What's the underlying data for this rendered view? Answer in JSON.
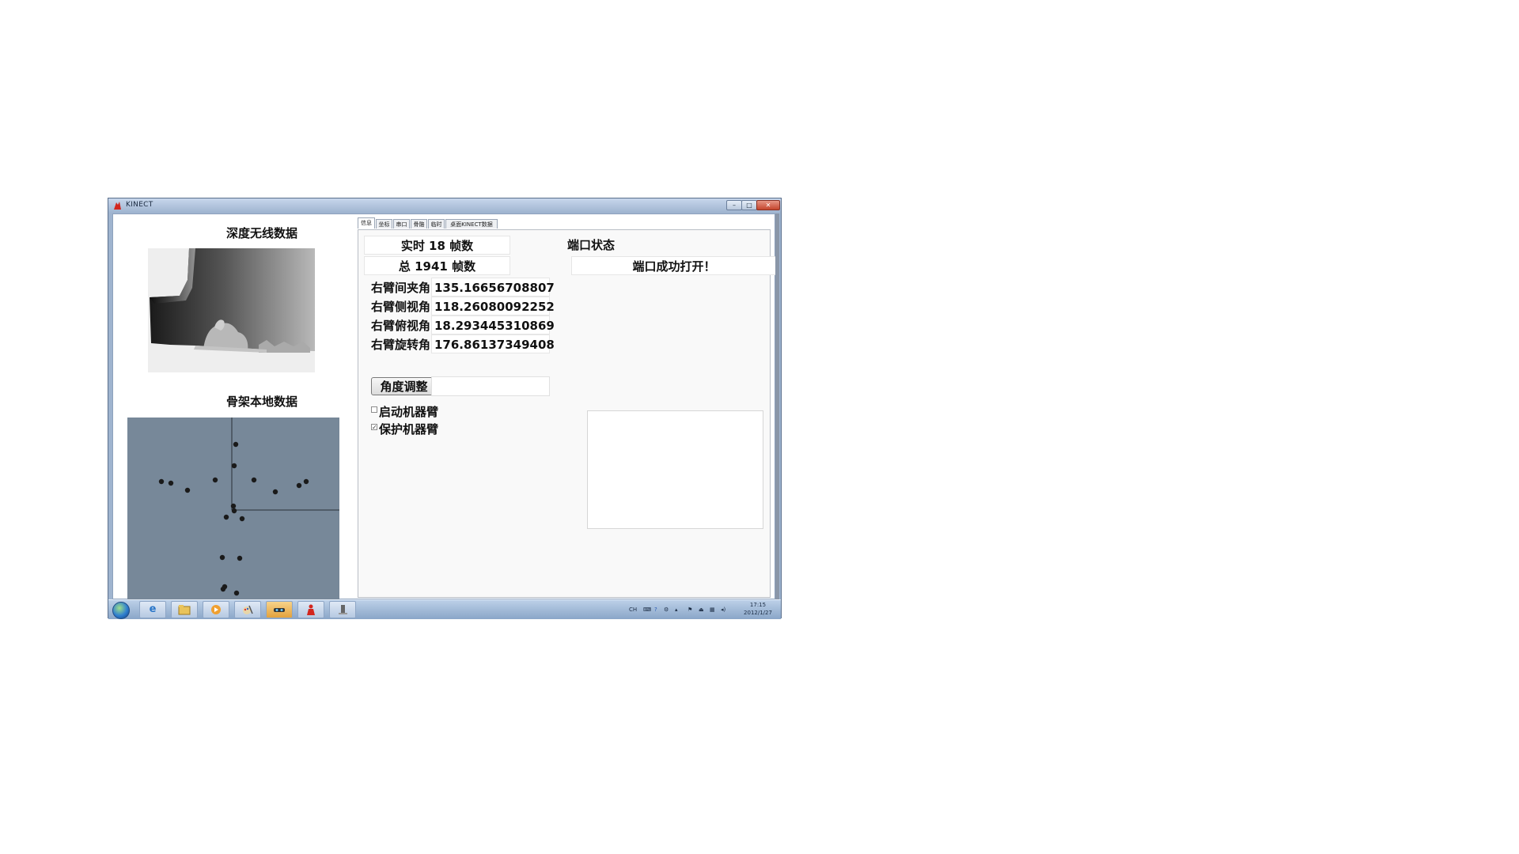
{
  "window": {
    "title": "KINECT",
    "min_glyph": "–",
    "max_glyph": "□",
    "close_glyph": "✕"
  },
  "left_panel": {
    "depth_title": "深度无线数据",
    "skeleton_title": "骨架本地数据"
  },
  "tabs": [
    {
      "label": "信息",
      "active": true
    },
    {
      "label": "坐标",
      "active": false
    },
    {
      "label": "串口",
      "active": false
    },
    {
      "label": "骨骼",
      "active": false
    },
    {
      "label": "临时",
      "active": false
    },
    {
      "label": "桌面KINECT数据",
      "active": false
    }
  ],
  "info": {
    "fps_text": "实时 18 帧数",
    "total_text": "总 1941 帧数",
    "port_title": "端口状态",
    "port_status": "端口成功打开！",
    "rows": [
      {
        "label": "右臂间夹角",
        "value": "135.16656708807"
      },
      {
        "label": "右臂侧视角",
        "value": "118.26080092252"
      },
      {
        "label": "右臂俯视角",
        "value": "18.293445310869"
      },
      {
        "label": "右臂旋转角",
        "value": "176.86137349408"
      }
    ],
    "adjust_button": "角度调整",
    "adjust_value": "",
    "checkboxes": [
      {
        "label": "启动机器臂",
        "checked": false
      },
      {
        "label": "保护机器臂",
        "checked": true
      }
    ],
    "check_glyph": "✓"
  },
  "taskbar": {
    "icons": [
      "windows-start-icon",
      "internet-explorer-icon",
      "folder-icon",
      "media-player-icon",
      "paint-icon",
      "kinect-app-icon",
      "kinect-red-icon",
      "device-icon"
    ],
    "tray_lang": "CH",
    "clock_time": "17:15",
    "clock_date": "2012/1/27"
  },
  "colors": {
    "skeleton_bg": "#778899",
    "joint": "#1a1a1a",
    "titlebar": "#b3c6df",
    "taskbar": "#a7bedc"
  }
}
